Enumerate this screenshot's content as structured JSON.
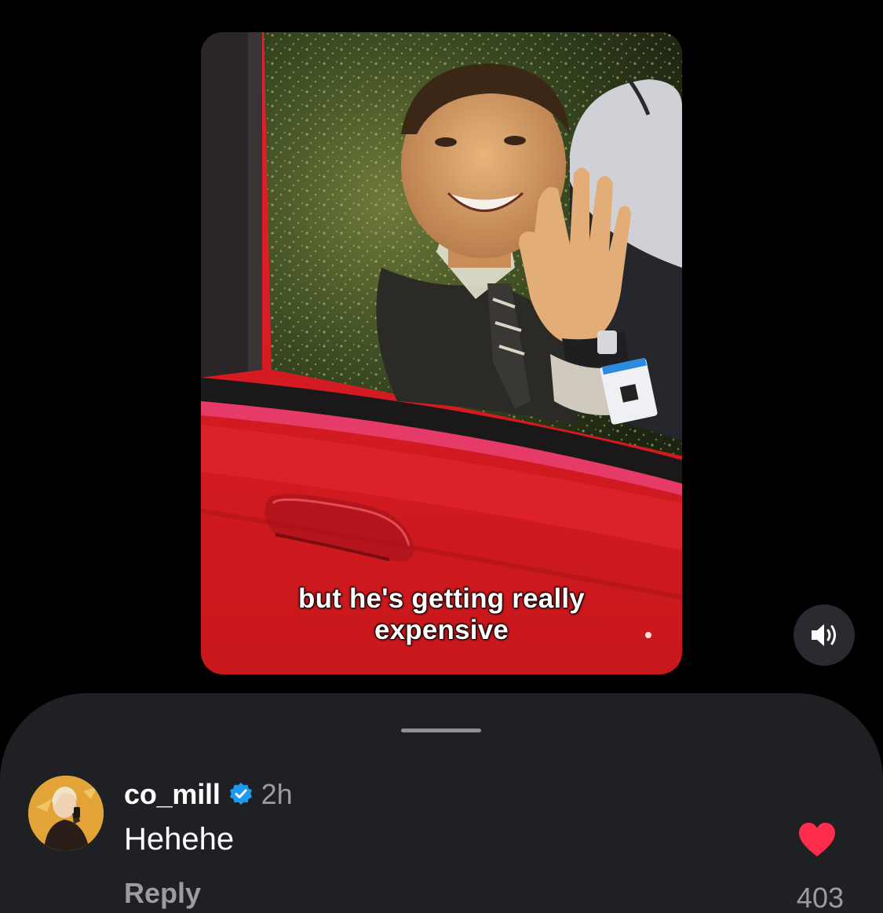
{
  "video": {
    "caption_line1": "but he's getting really",
    "caption_line2": "expensive",
    "sound_icon": "speaker-on-icon"
  },
  "comment": {
    "username": "co_mill",
    "verified": true,
    "timestamp": "2h",
    "text": "Hehehe",
    "reply_label": "Reply",
    "liked": true,
    "like_count": "403"
  },
  "colors": {
    "background": "#000000",
    "sheet": "#1f2024",
    "like_red": "#ff2d4b",
    "verified_blue": "#1d9bf0",
    "secondary_text": "#9a9ca2",
    "car_red": "#d01c22"
  }
}
